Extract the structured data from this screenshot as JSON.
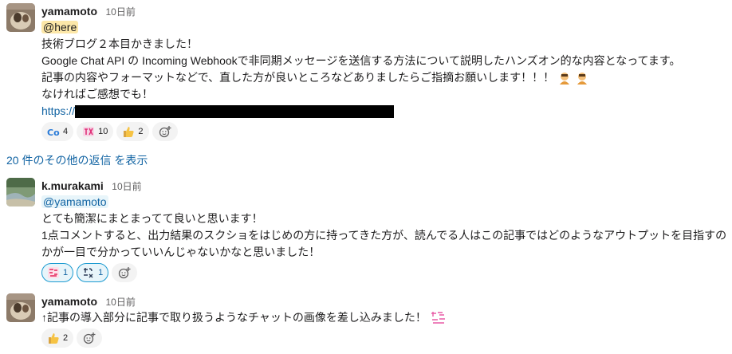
{
  "messages": [
    {
      "author": "yamamoto",
      "time": "10日前",
      "mention": "@here",
      "lines": [
        "技術ブログ２本目かきました！",
        "Google Chat API の Incoming Webhookで非同期メッセージを送信する方法について説明したハンズオン的な内容となってます。",
        "記事の内容やフォーマットなどで、直した方が良いところなどありましたらご指摘お願いします！！！",
        "なければご感想でも！"
      ],
      "link_prefix": "https://",
      "reactions": [
        {
          "emoji": "cool-emoji",
          "count": "4"
        },
        {
          "emoji": "sugoi-emoji",
          "count": "10"
        },
        {
          "emoji": "thumbsup-emoji",
          "count": "2"
        }
      ]
    },
    {
      "author": "k.murakami",
      "time": "10日前",
      "mention": "@yamamoto",
      "lines": [
        "とても簡潔にまとまってて良いと思います！",
        "1点コメントすると、出力結果のスクショをはじめの方に持ってきた方が、読んでる人はこの記事ではどのようなアウトプットを目指すのかが一目で分かっていいんじゃないかなと思いました！"
      ],
      "reactions": [
        {
          "emoji": "naruhodo-emoji",
          "count": "1"
        },
        {
          "emoji": "tashikani-emoji",
          "count": "1"
        }
      ]
    },
    {
      "author": "yamamoto",
      "time": "10日前",
      "lines": [
        "↑記事の導入部分に記事で取り扱うようなチャットの画像を差し込みました！"
      ],
      "reactions": [
        {
          "emoji": "thumbsup-emoji",
          "count": "2"
        }
      ]
    }
  ],
  "thread": {
    "more_replies": "20 件のその他の返信 を表示"
  },
  "colors": {
    "link": "#1264a3",
    "mention_here_bg": "#fce7a8",
    "mention_user_bg": "#e8f5fa"
  }
}
